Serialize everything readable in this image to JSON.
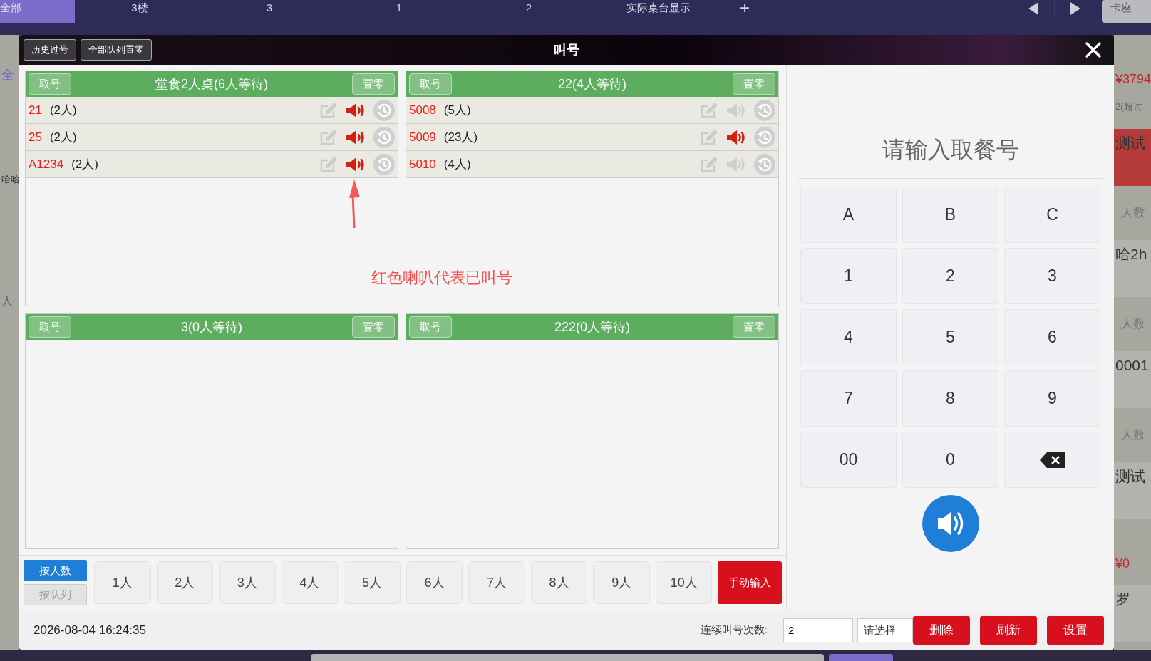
{
  "nav": {
    "tabs": [
      {
        "label": "全部",
        "selected": true
      },
      {
        "label": "3楼",
        "selected": false
      },
      {
        "label": "3",
        "selected": false
      },
      {
        "label": "1",
        "selected": false
      },
      {
        "label": "2",
        "selected": false
      },
      {
        "label": "实际桌台显示",
        "selected": false
      }
    ],
    "add": "+",
    "right_tab": "卡座"
  },
  "background_left": [
    {
      "text": "全",
      "kind": "link"
    },
    {
      "text": "哈哈",
      "kind": "note"
    },
    {
      "text": "人",
      "kind": "label"
    }
  ],
  "background_right": [
    {
      "text": "¥3794",
      "kind": "price"
    },
    {
      "text": "2(超过",
      "kind": "note"
    },
    {
      "text": "测试",
      "kind": "name-alert"
    },
    {
      "text": "人数",
      "kind": "label"
    },
    {
      "text": "哈2h",
      "kind": "name"
    },
    {
      "text": "人数",
      "kind": "label"
    },
    {
      "text": "0001",
      "kind": "name"
    },
    {
      "text": "人数",
      "kind": "label"
    },
    {
      "text": "测试",
      "kind": "name"
    },
    {
      "text": "¥0",
      "kind": "price"
    },
    {
      "text": "罗",
      "kind": "name"
    }
  ],
  "dialog": {
    "title": "叫号",
    "header_buttons": [
      "历史过号",
      "全部队列置零"
    ],
    "queues": [
      {
        "take_button": "取号",
        "title": "堂食2人桌(6人等待)",
        "reset_button": "置零",
        "rows": [
          {
            "number": "21",
            "people": "(2人)",
            "called": true
          },
          {
            "number": "25",
            "people": "(2人)",
            "called": true
          },
          {
            "number": "A1234",
            "people": "(2人)",
            "called": true
          }
        ]
      },
      {
        "take_button": "取号",
        "title": "22(4人等待)",
        "reset_button": "置零",
        "rows": [
          {
            "number": "5008",
            "people": "(5人)",
            "called": false
          },
          {
            "number": "5009",
            "people": "(23人)",
            "called": true
          },
          {
            "number": "5010",
            "people": "(4人)",
            "called": false
          }
        ]
      },
      {
        "take_button": "取号",
        "title": "3(0人等待)",
        "reset_button": "置零"
      },
      {
        "take_button": "取号",
        "title": "222(0人等待)",
        "reset_button": "置零"
      }
    ],
    "annotation": "红色喇叭代表已叫号",
    "modes": [
      {
        "label": "按人数",
        "selected": true
      },
      {
        "label": "按队列",
        "selected": false
      }
    ],
    "party_sizes": [
      "1人",
      "2人",
      "3人",
      "4人",
      "5人",
      "6人",
      "7人",
      "8人",
      "9人",
      "10人"
    ],
    "manual_button": "手动输入",
    "prompt": "请输入取餐号",
    "keys": [
      {
        "kind": "key",
        "label": "A"
      },
      {
        "kind": "key",
        "label": "B"
      },
      {
        "kind": "key",
        "label": "C"
      },
      {
        "kind": "key",
        "label": "1"
      },
      {
        "kind": "key",
        "label": "2"
      },
      {
        "kind": "key",
        "label": "3"
      },
      {
        "kind": "key",
        "label": "4"
      },
      {
        "kind": "key",
        "label": "5"
      },
      {
        "kind": "key",
        "label": "6"
      },
      {
        "kind": "key",
        "label": "7"
      },
      {
        "kind": "key",
        "label": "8"
      },
      {
        "kind": "key",
        "label": "9"
      },
      {
        "kind": "key",
        "label": "00"
      },
      {
        "kind": "key",
        "label": "0"
      },
      {
        "kind": "backspace"
      }
    ],
    "footer": {
      "datetime": "2026-08-04 16:24:35",
      "repeat_label": "连续叫号次数:",
      "repeat_value": "2",
      "select_placeholder": "请选择",
      "buttons": [
        "删除",
        "刷新",
        "设置"
      ]
    }
  }
}
